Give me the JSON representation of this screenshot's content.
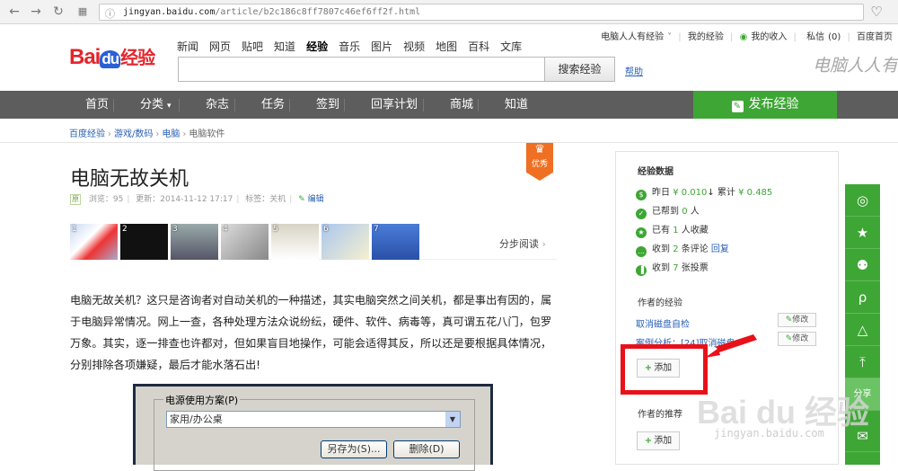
{
  "browser": {
    "url_domain": "jingyan.baidu.com",
    "url_path": "/article/b2c186c8ff7807c46ef6ff2f.html",
    "back_icon": "arrow-left",
    "forward_icon": "arrow-right",
    "reload_icon": "reload"
  },
  "top_links": {
    "user": "电脑人人有经验",
    "my_jingyan": "我的经验",
    "my_income": "我的收入",
    "messages": "私信",
    "messages_count": "(0)",
    "baidu_home": "百度首页"
  },
  "logo": {
    "bai": "Bai",
    "du": "du",
    "name": "经验"
  },
  "channels": [
    "新闻",
    "网页",
    "贴吧",
    "知道",
    "经验",
    "音乐",
    "图片",
    "视频",
    "地图",
    "百科",
    "文库"
  ],
  "search": {
    "value": "",
    "button": "搜索经验",
    "help": "帮助"
  },
  "watermark_top": "电脑人人有",
  "mainnav": {
    "items": [
      "首页",
      "分类",
      "杂志",
      "任务",
      "签到",
      "回享计划",
      "商城",
      "知道"
    ],
    "publish": "发布经验"
  },
  "breadcrumb": [
    "百度经验",
    "游戏/数码",
    "电脑",
    "电脑软件"
  ],
  "article": {
    "title": "电脑无故关机",
    "badge": "优秀",
    "original_mark": "原",
    "views": "浏览：95",
    "updated": "更新：2014-11-12 17:17",
    "tags": "标签：关机",
    "edit": "编辑",
    "step_numbers": [
      "1",
      "2",
      "3",
      "4",
      "5",
      "6",
      "7"
    ],
    "step_read": "分步阅读",
    "paragraph": "电脑无故关机？这只是咨询者对自动关机的一种描述，其实电脑突然之间关机，都是事出有因的，属于电脑异常情况。网上一查，各种处理方法众说纷纭，硬件、软件、病毒等，真可谓五花八门，包罗万象。其实，逐一排查也许都对，但如果盲目地操作，可能会适得其反，所以还是要根据具体情况，分别排除各项嫌疑，最后才能水落石出!",
    "screenshot": {
      "group_label": "电源使用方案",
      "group_hotkey": "(P)",
      "select_value": "家用/办公桌",
      "save_as": "另存为(S)...",
      "delete": "删除(D)"
    }
  },
  "sidebar": {
    "data_title": "经验数据",
    "stats": [
      {
        "pre": "昨日 ",
        "v1": "¥ 0.010",
        "mid": "↓ 累计 ",
        "v2": "¥ 0.485",
        "post": ""
      },
      {
        "pre": "已帮到 ",
        "v1": "0",
        "mid": " 人",
        "v2": "",
        "post": ""
      },
      {
        "pre": "已有 ",
        "v1": "1",
        "mid": " 人收藏",
        "v2": "",
        "post": ""
      },
      {
        "pre": "收到 ",
        "v1": "2",
        "mid": " 条评论 ",
        "v2": "",
        "post": "回复"
      },
      {
        "pre": "收到 ",
        "v1": "7",
        "mid": " 张投票",
        "v2": "",
        "post": ""
      }
    ],
    "author_exp_title": "作者的经验",
    "exp_items": [
      "取消磁盘自检",
      "案例分析：[24]取消磁盘"
    ],
    "modify": "修改",
    "add": "添加",
    "recommend_title": "作者的推荐"
  },
  "share": {
    "label": "分享",
    "icons": [
      "weibo-icon",
      "favorite-icon",
      "wechat-icon",
      "renren-icon",
      "kaixin-icon",
      "qzone-icon"
    ]
  },
  "watermark_bottom": "Bai du 经验",
  "watermark_url": "jingyan.baidu.com",
  "colors": {
    "green": "#3ea635",
    "nav": "#5d5d5d",
    "link": "#2a60b5",
    "red": "#e8111a",
    "badge": "#ef6f23"
  }
}
